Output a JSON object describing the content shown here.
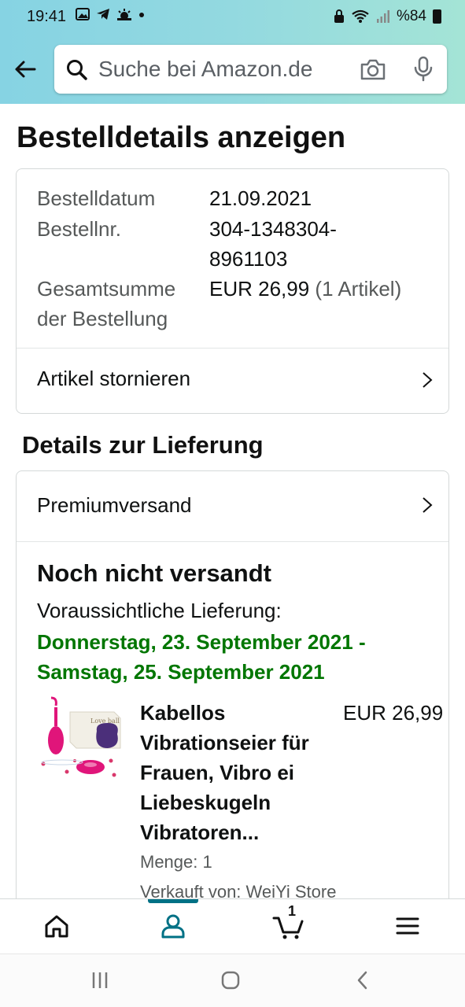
{
  "status_bar": {
    "time": "19:41",
    "battery": "%84",
    "icons": [
      "image-icon",
      "telegram-icon",
      "weather-icon",
      "dot-icon",
      "lock-icon",
      "wifi-icon",
      "signal-icon",
      "battery-icon"
    ]
  },
  "search": {
    "placeholder": "Suche bei Amazon.de"
  },
  "page": {
    "title": "Bestelldetails anzeigen"
  },
  "order": {
    "date_label": "Bestelldatum",
    "date_value": "21.09.2021",
    "number_label": "Bestellnr.",
    "number_value_line1": "304-1348304-",
    "number_value_line2": "8961103",
    "total_label_line1": "Gesamtsumme",
    "total_label_line2": "der Bestellung",
    "total_value": "EUR 26,99",
    "total_items": "(1 Artikel)",
    "cancel_label": "Artikel stornieren"
  },
  "delivery": {
    "heading": "Details zur Lieferung",
    "shipping_method": "Premiumversand",
    "status": "Noch nicht versandt",
    "expected_label": "Voraussichtliche Lieferung:",
    "date_line1": "Donnerstag, 23. September 2021 -",
    "date_line2": "Samstag, 25. September 2021"
  },
  "product": {
    "name_lines": [
      "Kabellos",
      "Vibrationseier für",
      "Frauen, Vibro ei",
      "Liebeskugeln",
      "Vibratoren..."
    ],
    "price": "EUR 26,99",
    "quantity": "Menge: 1",
    "seller": "Verkauft von: WeiYi Store",
    "box_text": "Love ball"
  },
  "tabs": {
    "cart_count": "1",
    "active": "account"
  },
  "colors": {
    "header_gradient_start": "#86d3e3",
    "header_gradient_end": "#a4e4d6",
    "green": "#007600",
    "teal": "#007185"
  }
}
